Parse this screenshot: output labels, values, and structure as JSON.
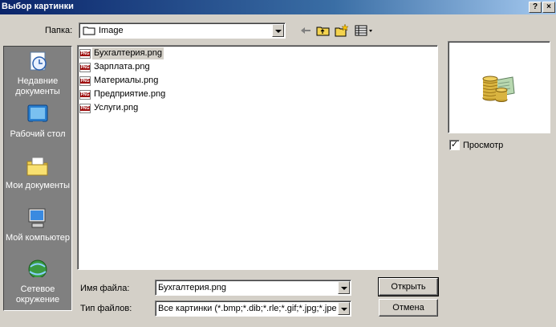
{
  "window": {
    "title": "Выбор картинки",
    "help_label": "?",
    "close_label": "×"
  },
  "lookin": {
    "label": "Папка:",
    "value": "Image"
  },
  "places": [
    {
      "label": "Недавние документы"
    },
    {
      "label": "Рабочий стол"
    },
    {
      "label": "Мои документы"
    },
    {
      "label": "Мой компьютер"
    },
    {
      "label": "Сетевое окружение"
    }
  ],
  "files": [
    {
      "name": "Бухгалтерия.png"
    },
    {
      "name": "Зарплата.png"
    },
    {
      "name": "Материалы.png"
    },
    {
      "name": "Предприятие.png"
    },
    {
      "name": "Услуги.png"
    }
  ],
  "filename": {
    "label": "Имя файла:",
    "value": "Бухгалтерия.png"
  },
  "filetype": {
    "label": "Тип файлов:",
    "value": "Все картинки (*.bmp;*.dib;*.rle;*.gif;*.jpg;*.jpeg"
  },
  "buttons": {
    "open": "Открыть",
    "cancel": "Отмена"
  },
  "preview": {
    "checkbox_label": "Просмотр",
    "checked": true,
    "check_mark": "✓"
  }
}
